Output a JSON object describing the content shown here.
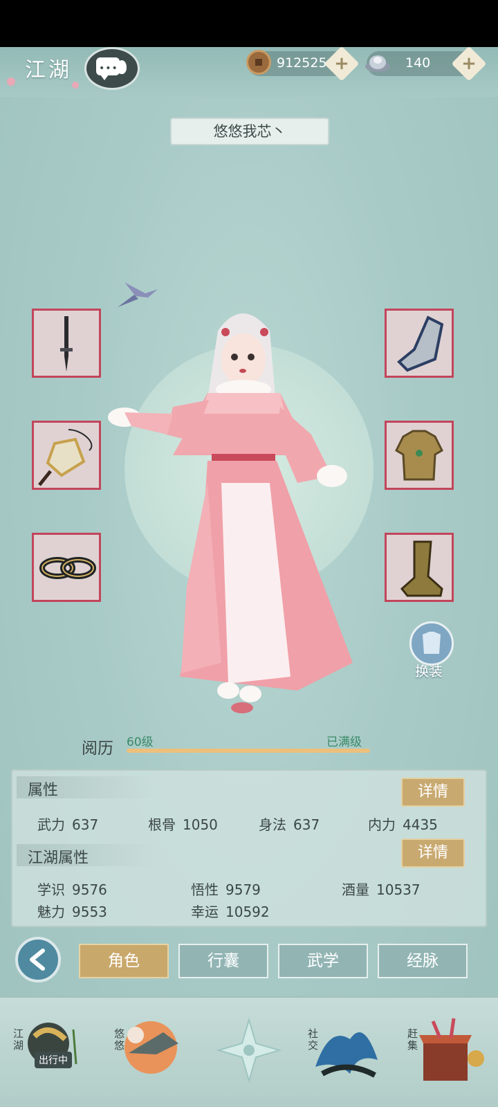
{
  "topbar": {
    "title": "江湖",
    "chat_icon": "chat-bubble-icon",
    "copper": {
      "icon": "copper-coin-icon",
      "value": "912525",
      "add_icon": "plus-icon"
    },
    "silver": {
      "icon": "silver-ingot-icon",
      "value": "140",
      "add_icon": "plus-icon"
    }
  },
  "character": {
    "name": "悠悠我芯丶",
    "change_outfit_label": "换装"
  },
  "equipment": {
    "left": [
      {
        "slot": "weapon",
        "icon": "sword-icon"
      },
      {
        "slot": "ornament",
        "icon": "jade-pendant-icon"
      },
      {
        "slot": "accessory",
        "icon": "rings-icon"
      }
    ],
    "right": [
      {
        "slot": "bracer",
        "icon": "bracer-icon"
      },
      {
        "slot": "armor",
        "icon": "armor-icon"
      },
      {
        "slot": "boots",
        "icon": "boots-icon"
      }
    ]
  },
  "experience": {
    "label": "阅历",
    "level": "60级",
    "status": "已满级",
    "progress": 1.0
  },
  "attributes": {
    "title": "属性",
    "detail_label": "详情",
    "items": [
      {
        "name": "武力",
        "value": "637"
      },
      {
        "name": "根骨",
        "value": "1050"
      },
      {
        "name": "身法",
        "value": "637"
      },
      {
        "name": "内力",
        "value": "4435"
      }
    ]
  },
  "jianghu_attributes": {
    "title": "江湖属性",
    "detail_label": "详情",
    "items": [
      {
        "name": "学识",
        "value": "9576"
      },
      {
        "name": "悟性",
        "value": "9579"
      },
      {
        "name": "酒量",
        "value": "10537"
      },
      {
        "name": "魅力",
        "value": "9553"
      },
      {
        "name": "幸运",
        "value": "10592"
      }
    ]
  },
  "tabs": [
    {
      "label": "角色",
      "active": true
    },
    {
      "label": "行囊",
      "active": false
    },
    {
      "label": "武学",
      "active": false
    },
    {
      "label": "经脉",
      "active": false
    }
  ],
  "bottom_nav": [
    {
      "label": "江湖",
      "badge": "出行中"
    },
    {
      "label": "悠悠"
    },
    {
      "label": ""
    },
    {
      "label": "社交"
    },
    {
      "label": "赶集"
    }
  ],
  "colors": {
    "accent_gold": "#c9a86b",
    "tab_inactive": "#92b5b4",
    "slot_border": "#c2455b",
    "exp_text": "#3a8a67"
  }
}
